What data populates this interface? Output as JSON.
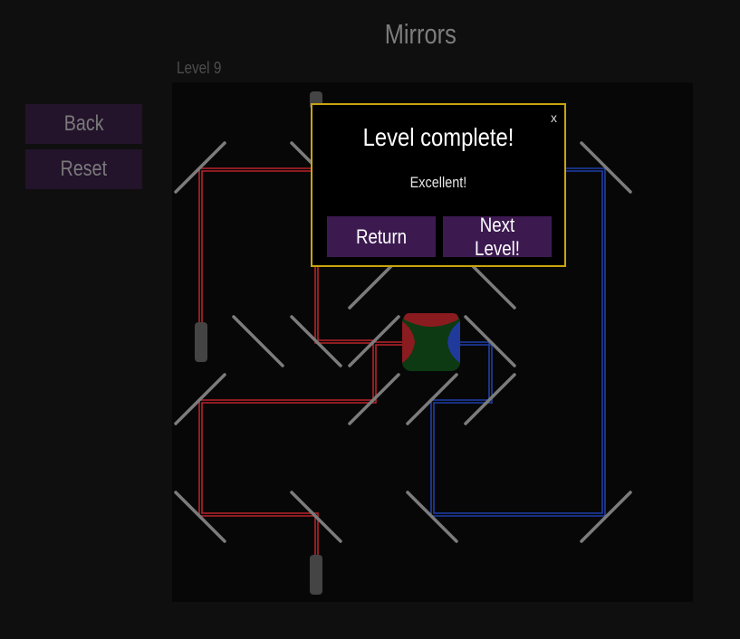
{
  "page": {
    "title": "Mirrors",
    "level_label": "Level 9"
  },
  "sidebar": {
    "back_label": "Back",
    "reset_label": "Reset"
  },
  "dialog": {
    "close_label": "x",
    "title": "Level complete!",
    "message": "Excellent!",
    "return_label": "Return",
    "next_label": "Next Level!"
  },
  "colors": {
    "background": "#0f0f0f",
    "board": "#070707",
    "button": "#23132b",
    "dialog_button": "#3c1a50",
    "dialog_border": "#c9a40f",
    "laser_red": "#b8232a",
    "laser_blue": "#1f3fa8",
    "mirror": "#7c7c7c",
    "target_green": "#0d3a12"
  }
}
